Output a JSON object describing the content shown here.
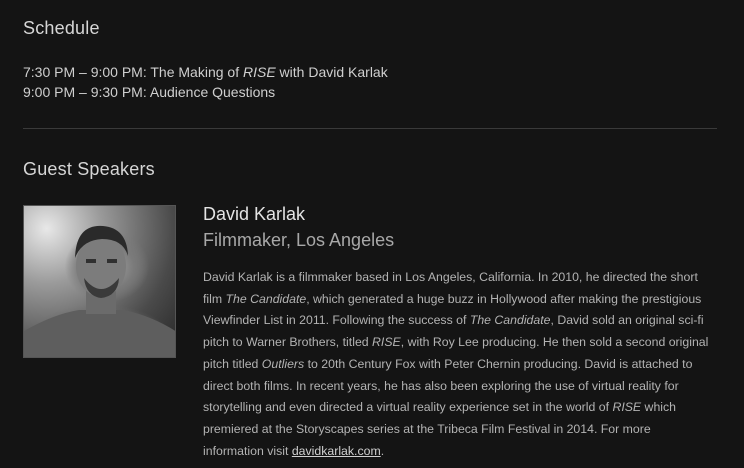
{
  "schedule": {
    "title": "Schedule",
    "items": [
      {
        "time": "7:30 PM – 9:00 PM: ",
        "text_before": "The Making of ",
        "emph": "RISE",
        "text_after": " with David Karlak"
      },
      {
        "time": "9:00 PM – 9:30 PM: ",
        "text_before": "Audience Questions",
        "emph": "",
        "text_after": ""
      }
    ]
  },
  "speakers": {
    "title": "Guest Speakers",
    "items": [
      {
        "name": "David Karlak",
        "role": "Filmmaker, Los Angeles",
        "bio": {
          "p1": "David Karlak is a filmmaker based in Los Angeles, California. In 2010, he directed the short film ",
          "e1": "The Candidate",
          "p2": ", which generated a huge buzz in Hollywood after making the prestigious Viewfinder List in 2011. Following the success of ",
          "e2": "The Candidate",
          "p3": ", David sold an original sci-fi pitch to Warner Brothers, titled ",
          "e3": "RISE",
          "p4": ", with Roy Lee producing. He then sold a second original pitch titled ",
          "e4": "Outliers",
          "p5": " to 20th Century Fox with Peter Chernin producing. David is attached to direct both films. In recent years, he has also been exploring the use of virtual reality for storytelling and even directed a virtual reality experience set in the world of ",
          "e5": "RISE",
          "p6": " which premiered at the Storyscapes series at the Tribeca Film Festival in 2014. For more information visit ",
          "link": "davidkarlak.com",
          "p7": "."
        }
      }
    ]
  }
}
